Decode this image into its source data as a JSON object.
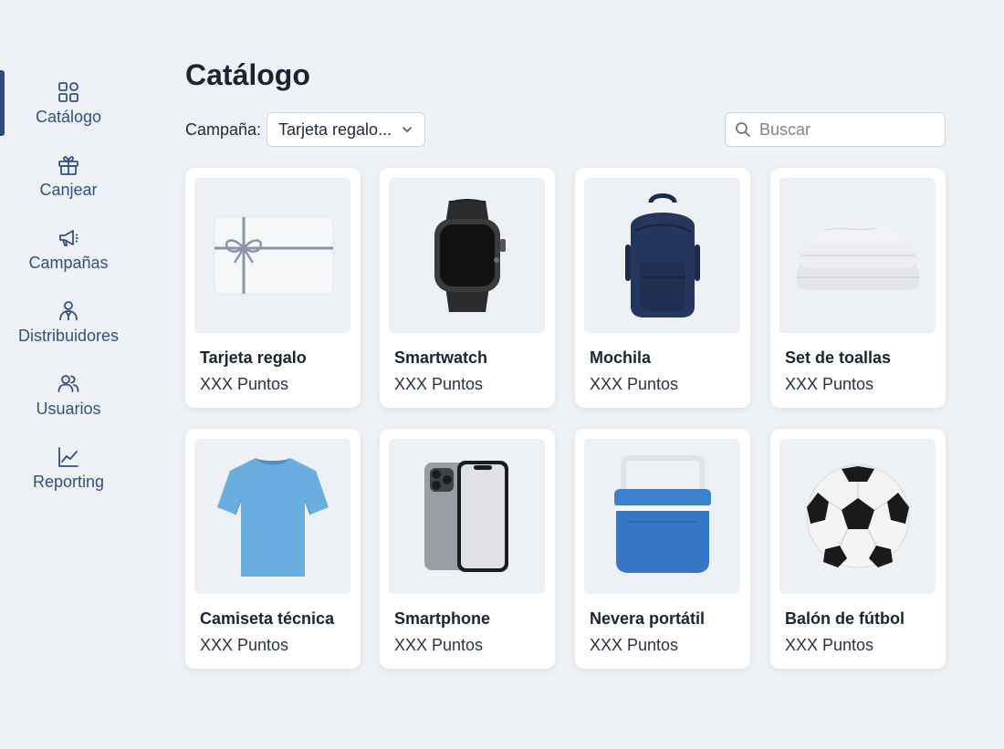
{
  "sidebar": {
    "items": [
      {
        "label": "Catálogo",
        "icon": "grid-icon",
        "active": true
      },
      {
        "label": "Canjear",
        "icon": "gift-icon"
      },
      {
        "label": "Campañas",
        "icon": "megaphone-icon"
      },
      {
        "label": "Distribuidores",
        "icon": "distributor-icon"
      },
      {
        "label": "Usuarios",
        "icon": "users-icon"
      },
      {
        "label": "Reporting",
        "icon": "line-chart-icon"
      }
    ],
    "accent_color": "#2f4a7a"
  },
  "header": {
    "title": "Catálogo"
  },
  "filters": {
    "campaign_label": "Campaña:",
    "campaign_value": "Tarjeta regalo...",
    "search_placeholder": "Buscar"
  },
  "products": [
    {
      "name": "Tarjeta regalo",
      "points": "XXX Puntos",
      "image": "gift-card-image"
    },
    {
      "name": "Smartwatch",
      "points": "XXX Puntos",
      "image": "smartwatch-image"
    },
    {
      "name": "Mochila",
      "points": "XXX Puntos",
      "image": "backpack-image"
    },
    {
      "name": "Set de toallas",
      "points": "XXX Puntos",
      "image": "towels-image"
    },
    {
      "name": "Camiseta técnica",
      "points": "XXX Puntos",
      "image": "tshirt-image"
    },
    {
      "name": "Smartphone",
      "points": "XXX Puntos",
      "image": "smartphone-image"
    },
    {
      "name": "Nevera portátil",
      "points": "XXX Puntos",
      "image": "cooler-image"
    },
    {
      "name": "Balón de fútbol",
      "points": "XXX Puntos",
      "image": "soccer-ball-image"
    }
  ]
}
